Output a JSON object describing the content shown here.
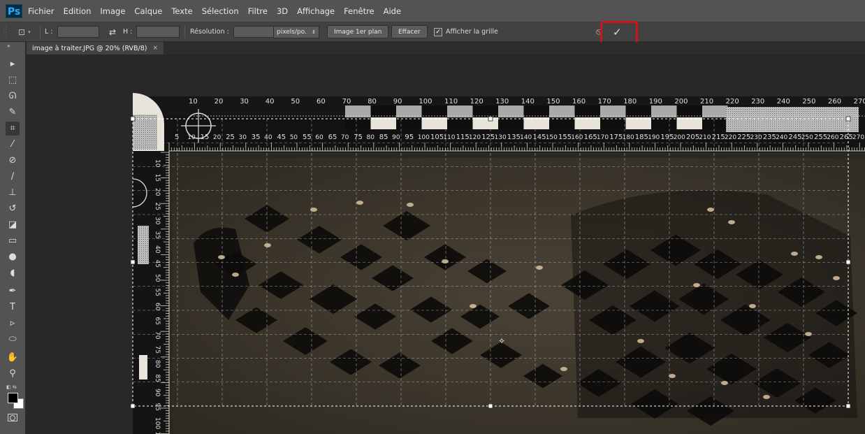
{
  "app": {
    "logo_text": "Ps"
  },
  "menu": [
    "Fichier",
    "Edition",
    "Image",
    "Calque",
    "Texte",
    "Sélection",
    "Filtre",
    "3D",
    "Affichage",
    "Fenêtre",
    "Aide"
  ],
  "options": {
    "width_label": "L :",
    "height_label": "H :",
    "swap_icon": "swap-arrows-icon",
    "resolution_label": "Résolution :",
    "unit_value": "pixels/po.",
    "front_image_button": "Image 1er plan",
    "clear_button": "Effacer",
    "show_grid_label": "Afficher la grille",
    "show_grid_checked": true,
    "cancel_icon": "cancel-icon",
    "commit_icon": "commit-checkmark-icon"
  },
  "document_tab": {
    "title": "image à traiter.JPG @ 20% (RVB/8)",
    "close": "×"
  },
  "toolbar_tools": [
    "move-tool-icon",
    "marquee-tool-icon",
    "lasso-tool-icon",
    "quick-select-tool-icon",
    "crop-tool-icon",
    "eyedropper-tool-icon",
    "healing-brush-tool-icon",
    "brush-tool-icon",
    "clone-stamp-tool-icon",
    "history-brush-tool-icon",
    "eraser-tool-icon",
    "gradient-tool-icon",
    "blur-tool-icon",
    "dodge-tool-icon",
    "pen-tool-icon",
    "type-tool-icon",
    "path-select-tool-icon",
    "ellipse-tool-icon",
    "hand-tool-icon",
    "zoom-tool-icon"
  ],
  "ruler": {
    "top_major": [
      "10",
      "20",
      "30",
      "40",
      "50",
      "60",
      "70",
      "80",
      "90",
      "100",
      "110",
      "120",
      "130",
      "140",
      "150",
      "160",
      "170",
      "180",
      "190",
      "200",
      "210",
      "220",
      "230",
      "240",
      "250",
      "260",
      "270"
    ],
    "bottom_major": [
      "5",
      "10",
      "15",
      "20",
      "25",
      "30",
      "35",
      "40",
      "45",
      "50",
      "55",
      "60",
      "65",
      "70",
      "75",
      "80",
      "85",
      "90",
      "95",
      "100",
      "105",
      "110",
      "115",
      "120",
      "125",
      "130",
      "135",
      "140",
      "145",
      "150",
      "155",
      "160",
      "165",
      "170",
      "175",
      "180",
      "185",
      "190",
      "195",
      "200",
      "205",
      "210",
      "215",
      "220",
      "225",
      "230",
      "235",
      "240",
      "245",
      "250",
      "255",
      "260",
      "265",
      "270"
    ],
    "left": [
      "10",
      "15",
      "20",
      "25",
      "30",
      "35",
      "40",
      "45",
      "50",
      "55",
      "60",
      "65",
      "70",
      "75",
      "80",
      "85",
      "90",
      "95",
      "100",
      "105"
    ]
  },
  "colors": {
    "highlight": "#d0121b",
    "ps_blue": "#31a8ff",
    "panel": "#535353"
  }
}
